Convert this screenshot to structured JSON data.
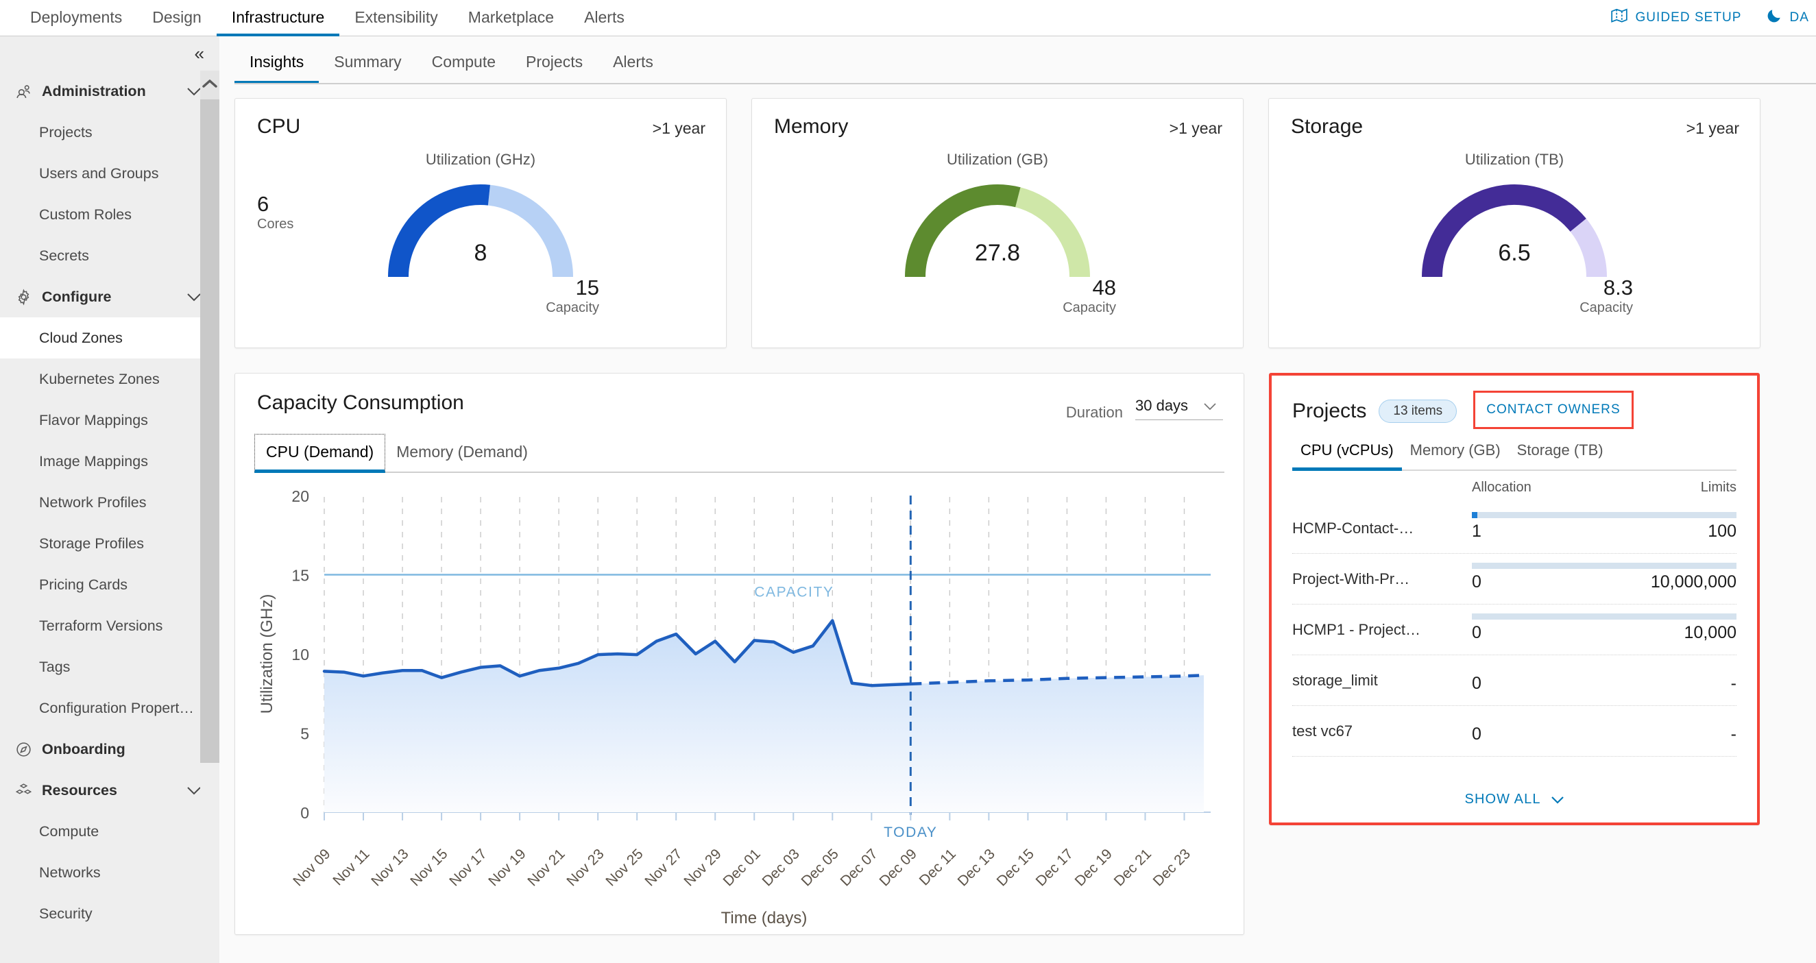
{
  "topnav": {
    "tabs": [
      {
        "label": "Deployments",
        "active": false
      },
      {
        "label": "Design",
        "active": false
      },
      {
        "label": "Infrastructure",
        "active": true
      },
      {
        "label": "Extensibility",
        "active": false
      },
      {
        "label": "Marketplace",
        "active": false
      },
      {
        "label": "Alerts",
        "active": false
      }
    ],
    "guided_setup": "GUIDED SETUP",
    "theme_toggle": "DA"
  },
  "sidebar": {
    "collapse_glyph": "«",
    "groups": [
      {
        "label": "Administration",
        "icon": "users-icon",
        "items": [
          "Projects",
          "Users and Groups",
          "Custom Roles",
          "Secrets"
        ]
      },
      {
        "label": "Configure",
        "icon": "gear-icon",
        "items": [
          "Cloud Zones",
          "Kubernetes Zones",
          "Flavor Mappings",
          "Image Mappings",
          "Network Profiles",
          "Storage Profiles",
          "Pricing Cards",
          "Terraform Versions",
          "Tags",
          "Configuration Propert…"
        ]
      },
      {
        "label": "Onboarding",
        "icon": "compass-icon",
        "items": []
      },
      {
        "label": "Resources",
        "icon": "blocks-icon",
        "items": [
          "Compute",
          "Networks",
          "Security"
        ]
      }
    ],
    "active_item": "Cloud Zones"
  },
  "subtabs": [
    {
      "label": "Insights",
      "active": true
    },
    {
      "label": "Summary",
      "active": false
    },
    {
      "label": "Compute",
      "active": false
    },
    {
      "label": "Projects",
      "active": false
    },
    {
      "label": "Alerts",
      "active": false
    }
  ],
  "gauges": [
    {
      "title": "CPU",
      "period": ">1 year",
      "utilization_label": "Utilization (GHz)",
      "value": "8",
      "capacity": "15",
      "capacity_label": "Capacity",
      "extra_value": "6",
      "extra_label": "Cores",
      "fill_color": "#1055c9",
      "track_color": "#b7d1f5",
      "fraction": 0.533
    },
    {
      "title": "Memory",
      "period": ">1 year",
      "utilization_label": "Utilization (GB)",
      "value": "27.8",
      "capacity": "48",
      "capacity_label": "Capacity",
      "extra_value": "",
      "extra_label": "",
      "fill_color": "#5d8b2f",
      "track_color": "#cfe7a8",
      "fraction": 0.58
    },
    {
      "title": "Storage",
      "period": ">1 year",
      "utilization_label": "Utilization (TB)",
      "value": "6.5",
      "capacity": "8.3",
      "capacity_label": "Capacity",
      "extra_value": "",
      "extra_label": "",
      "fill_color": "#432c97",
      "track_color": "#dad4f7",
      "fraction": 0.783
    }
  ],
  "capacity": {
    "title": "Capacity Consumption",
    "duration_label": "Duration",
    "duration_value": "30 days",
    "tabs": [
      {
        "label": "CPU (Demand)",
        "active": true
      },
      {
        "label": "Memory (Demand)",
        "active": false
      }
    ]
  },
  "chart_data": {
    "type": "area",
    "title": "Capacity Consumption",
    "xlabel": "Time (days)",
    "ylabel": "Utilization (GHz)",
    "ylim": [
      0,
      20
    ],
    "yticks": [
      0,
      5,
      10,
      15,
      20
    ],
    "grid": true,
    "capacity_line": {
      "value": 15,
      "label": "CAPACITY",
      "color": "#7fb8e0"
    },
    "today_marker": {
      "label": "TODAY",
      "x": "Dec 09",
      "color": "#2566b5"
    },
    "tick_labels": [
      "Nov 09",
      "Nov 11",
      "Nov 13",
      "Nov 15",
      "Nov 17",
      "Nov 19",
      "Nov 21",
      "Nov 23",
      "Nov 25",
      "Nov 27",
      "Nov 29",
      "Dec 01",
      "Dec 03",
      "Dec 05",
      "Dec 07",
      "Dec 09",
      "Dec 11",
      "Dec 13",
      "Dec 15",
      "Dec 17",
      "Dec 19",
      "Dec 21",
      "Dec 23"
    ],
    "series": [
      {
        "name": "CPU (Demand) actual",
        "style": "solid",
        "color": "#1f5fbf",
        "fill": "#dce9fa",
        "x": [
          "Nov 09",
          "Nov 10",
          "Nov 11",
          "Nov 12",
          "Nov 13",
          "Nov 14",
          "Nov 15",
          "Nov 16",
          "Nov 17",
          "Nov 18",
          "Nov 19",
          "Nov 20",
          "Nov 21",
          "Nov 22",
          "Nov 23",
          "Nov 24",
          "Nov 25",
          "Nov 26",
          "Nov 27",
          "Nov 28",
          "Nov 29",
          "Nov 30",
          "Dec 01",
          "Dec 02",
          "Dec 03",
          "Dec 04",
          "Dec 05",
          "Dec 06",
          "Dec 07",
          "Dec 08",
          "Dec 09"
        ],
        "values": [
          8.9,
          8.85,
          8.6,
          8.8,
          8.95,
          8.95,
          8.5,
          8.85,
          9.15,
          9.25,
          8.6,
          8.95,
          9.1,
          9.4,
          9.95,
          10.0,
          9.95,
          10.8,
          11.25,
          10.0,
          10.8,
          9.5,
          10.85,
          10.75,
          10.1,
          10.5,
          12.1,
          8.15,
          8.0,
          8.05,
          8.1
        ]
      },
      {
        "name": "CPU (Demand) forecast",
        "style": "dashed",
        "color": "#1f5fbf",
        "fill": "#e6effb",
        "x": [
          "Dec 09",
          "Dec 11",
          "Dec 13",
          "Dec 15",
          "Dec 17",
          "Dec 19",
          "Dec 21",
          "Dec 23",
          "Dec 24"
        ],
        "values": [
          8.1,
          8.2,
          8.3,
          8.35,
          8.45,
          8.5,
          8.55,
          8.6,
          8.65
        ]
      }
    ]
  },
  "projects": {
    "title": "Projects",
    "badge": "13 items",
    "contact_owners": "CONTACT OWNERS",
    "tabs": [
      {
        "label": "CPU (vCPUs)",
        "active": true
      },
      {
        "label": "Memory (GB)",
        "active": false
      },
      {
        "label": "Storage (TB)",
        "active": false
      }
    ],
    "columns": {
      "allocation": "Allocation",
      "limits": "Limits"
    },
    "rows": [
      {
        "name": "HCMP-Contact-…",
        "allocation": "1",
        "limit": "100",
        "has_bar": true,
        "fill_pct": 2
      },
      {
        "name": "Project-With-Pr…",
        "allocation": "0",
        "limit": "10,000,000",
        "has_bar": true,
        "fill_pct": 0
      },
      {
        "name": "HCMP1 - Project…",
        "allocation": "0",
        "limit": "10,000",
        "has_bar": true,
        "fill_pct": 0
      },
      {
        "name": "storage_limit",
        "allocation": "0",
        "limit": "-",
        "has_bar": false,
        "fill_pct": 0
      },
      {
        "name": "test vc67",
        "allocation": "0",
        "limit": "-",
        "has_bar": false,
        "fill_pct": 0
      }
    ],
    "show_all": "SHOW ALL"
  }
}
